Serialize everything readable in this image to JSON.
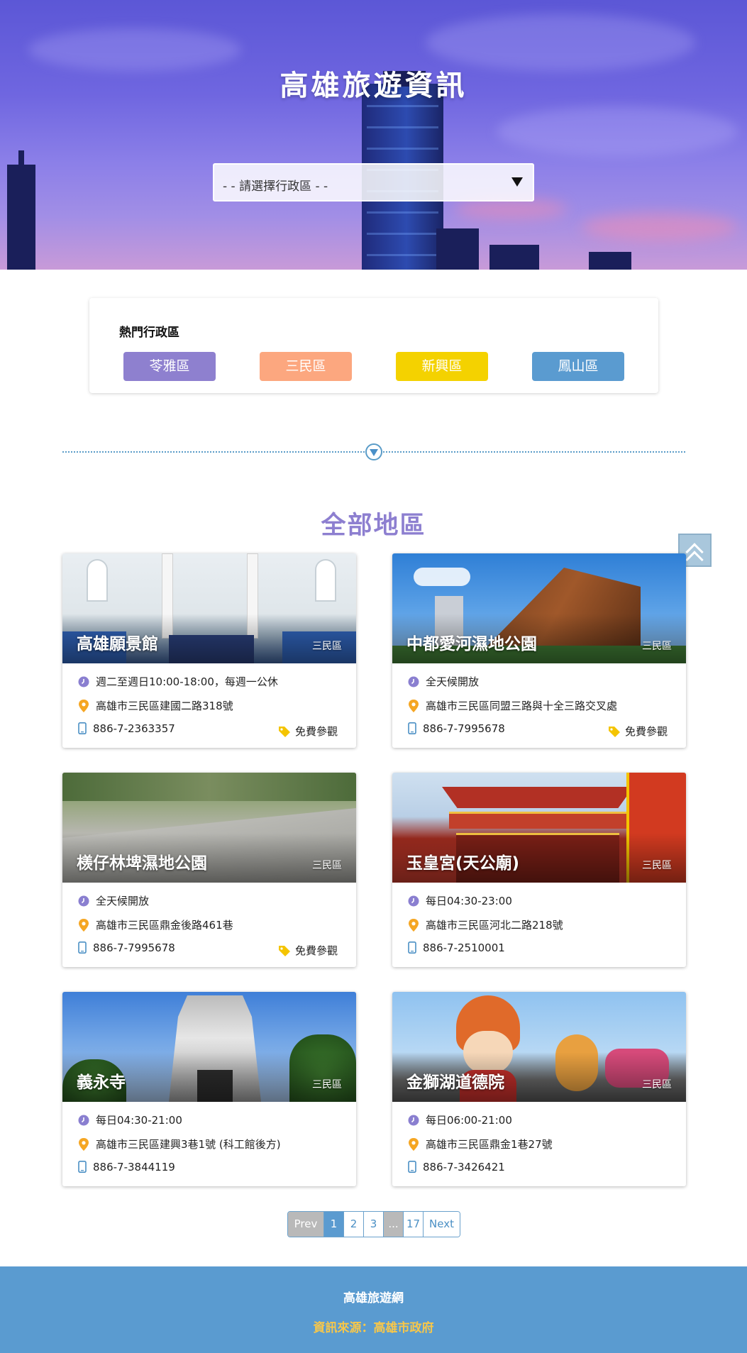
{
  "hero": {
    "title": "高雄旅遊資訊",
    "select_placeholder": "- - 請選擇行政區 - -"
  },
  "hot_districts": {
    "title": "熱門行政區",
    "items": [
      {
        "label": "苓雅區",
        "color": "#8e80cf"
      },
      {
        "label": "三民區",
        "color": "#fca77f"
      },
      {
        "label": "新興區",
        "color": "#f4d200"
      },
      {
        "label": "鳳山區",
        "color": "#5a9bd0"
      }
    ]
  },
  "section": {
    "title": "全部地區"
  },
  "icons": {
    "clock": "clock-icon",
    "pin": "location-pin-icon",
    "phone": "phone-icon",
    "tag": "tag-icon",
    "back_top": "double-chevron-up-icon"
  },
  "spots": [
    {
      "name": "高雄願景館",
      "district": "三民區",
      "hours": "週二至週日10:00-18:00，每週一公休",
      "address": "高雄市三民區建國二路318號",
      "phone": "886-7-2363357",
      "ticket": "免費參觀"
    },
    {
      "name": "中都愛河濕地公園",
      "district": "三民區",
      "hours": "全天候開放",
      "address": "高雄市三民區同盟三路與十全三路交叉處",
      "phone": "886-7-7995678",
      "ticket": "免費參觀"
    },
    {
      "name": "檨仔林埤濕地公園",
      "district": "三民區",
      "hours": "全天候開放",
      "address": "高雄市三民區鼎金後路461巷",
      "phone": "886-7-7995678",
      "ticket": "免費參觀"
    },
    {
      "name": "玉皇宮(天公廟)",
      "district": "三民區",
      "hours": "每日04:30-23:00",
      "address": "高雄市三民區河北二路218號",
      "phone": "886-7-2510001",
      "ticket": ""
    },
    {
      "name": "義永寺",
      "district": "三民區",
      "hours": "每日04:30-21:00",
      "address": "高雄市三民區建興3巷1號 (科工館後方)",
      "phone": "886-7-3844119",
      "ticket": ""
    },
    {
      "name": "金獅湖道德院",
      "district": "三民區",
      "hours": "每日06:00-21:00",
      "address": "高雄市三民區鼎金1巷27號",
      "phone": "886-7-3426421",
      "ticket": ""
    }
  ],
  "pagination": {
    "prev": "Prev",
    "pages": [
      "1",
      "2",
      "3"
    ],
    "ellipsis": "...",
    "last": "17",
    "next": "Next",
    "current": "1"
  },
  "footer": {
    "site": "高雄旅遊網",
    "source": "資訊來源：高雄市政府"
  }
}
